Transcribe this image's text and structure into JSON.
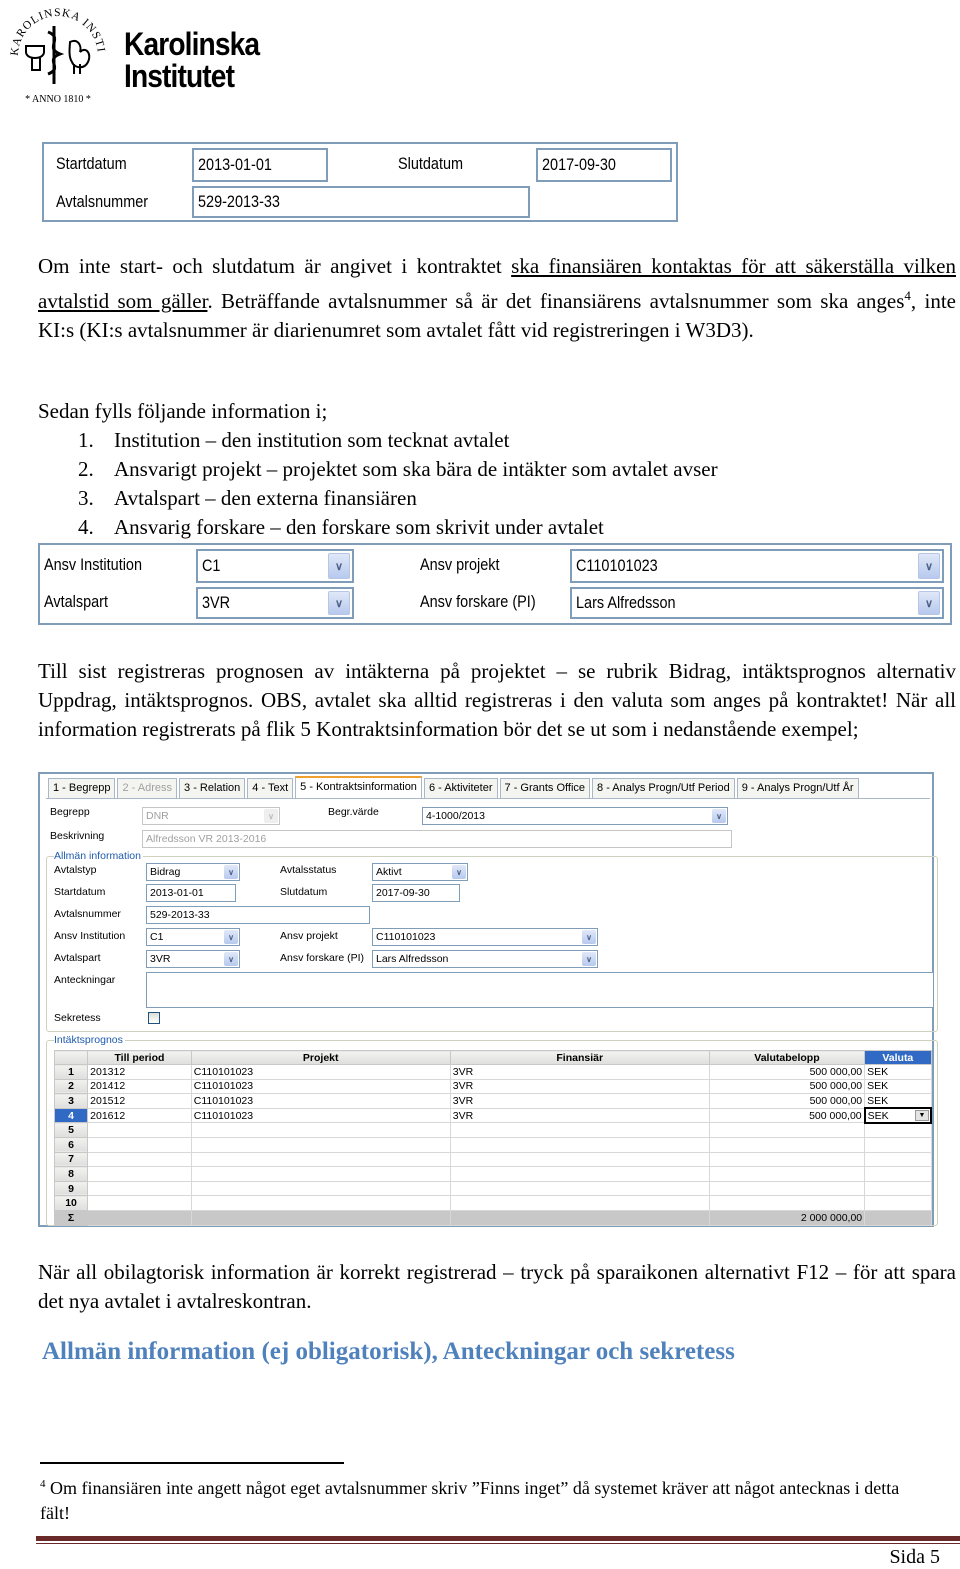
{
  "logo": {
    "seal_text": "KAROLINSKA INSTITUTET · ANNO 1810",
    "name_line1": "Karolinska",
    "name_line2": "Institutet"
  },
  "figure1": {
    "startdatum_label": "Startdatum",
    "startdatum_value": "2013-01-01",
    "slutdatum_label": "Slutdatum",
    "slutdatum_value": "2017-09-30",
    "avtalsnummer_label": "Avtalsnummer",
    "avtalsnummer_value": "529-2013-33"
  },
  "paragraph1": {
    "part1": "Om inte start- och slutdatum är angivet i kontraktet ",
    "underlined": "ska finansiären kontaktas för att säkerställa vilken avtalstid som gäller",
    "part2": ". Beträffande avtalsnummer så är det finansiärens avtalsnummer som ska anges",
    "footnote_ref": "4",
    "part3": ", inte KI:s (KI:s avtalsnummer är diarienumret som avtalet fått vid registreringen i W3D3)."
  },
  "list": {
    "intro": "Sedan fylls följande information i;",
    "items": [
      {
        "num": "1.",
        "text": "Institution – den institution som tecknat avtalet"
      },
      {
        "num": "2.",
        "text": "Ansvarigt projekt – projektet som ska bära de intäkter som avtalet avser"
      },
      {
        "num": "3.",
        "text": "Avtalspart – den externa finansiären"
      },
      {
        "num": "4.",
        "text": "Ansvarig forskare – den forskare som skrivit under avtalet"
      }
    ]
  },
  "figure2": {
    "ansv_institution_label": "Ansv Institution",
    "ansv_institution_value": "C1",
    "ansv_projekt_label": "Ansv projekt",
    "ansv_projekt_value": "C110101023",
    "avtalspart_label": "Avtalspart",
    "avtalspart_value": "3VR",
    "ansv_forskare_label": "Ansv forskare (PI)",
    "ansv_forskare_value": "Lars Alfredsson"
  },
  "paragraph2": "Till sist registreras prognosen av intäkterna på projektet – se rubrik Bidrag, intäktsprognos alternativ Uppdrag, intäktsprognos. OBS, avtalet ska alltid registreras i den valuta som anges på kontraktet! När all information registrerats på flik 5 Kontraktsinformation bör det se ut som i nedanstående exempel;",
  "app": {
    "tabs": [
      {
        "label": "1 - Begrepp",
        "state": "normal"
      },
      {
        "label": "2 - Adress",
        "state": "disabled"
      },
      {
        "label": "3 - Relation",
        "state": "normal"
      },
      {
        "label": "4 - Text",
        "state": "normal"
      },
      {
        "label": "5 - Kontraktsinformation",
        "state": "active"
      },
      {
        "label": "6 - Aktiviteter",
        "state": "normal"
      },
      {
        "label": "7 - Grants Office",
        "state": "normal"
      },
      {
        "label": "8 - Analys Progn/Utf Period",
        "state": "normal"
      },
      {
        "label": "9 - Analys Progn/Utf År",
        "state": "normal"
      }
    ],
    "begrepp_label": "Begrepp",
    "begrepp_value": "DNR",
    "begr_varde_label": "Begr.värde",
    "begr_varde_value": "4-1000/2013",
    "beskrivning_label": "Beskrivning",
    "beskrivning_value": "Alfredsson VR 2013-2016",
    "group_allman": "Allmän information",
    "avtalstyp_label": "Avtalstyp",
    "avtalstyp_value": "Bidrag",
    "avtalsstatus_label": "Avtalsstatus",
    "avtalsstatus_value": "Aktivt",
    "startdatum_label": "Startdatum",
    "startdatum_value": "2013-01-01",
    "slutdatum_label": "Slutdatum",
    "slutdatum_value": "2017-09-30",
    "avtalsnummer_label": "Avtalsnummer",
    "avtalsnummer_value": "529-2013-33",
    "ansv_institution_label": "Ansv Institution",
    "ansv_institution_value": "C1",
    "ansv_projekt_label": "Ansv projekt",
    "ansv_projekt_value": "C110101023",
    "avtalspart_label": "Avtalspart",
    "avtalspart_value": "3VR",
    "ansv_forskare_label": "Ansv forskare (PI)",
    "ansv_forskare_value": "Lars Alfredsson",
    "anteckningar_label": "Anteckningar",
    "anteckningar_value": "",
    "sekretess_label": "Sekretess",
    "sekretess_checked": false,
    "group_intakt": "Intäktsprognos",
    "grid": {
      "columns": [
        "Till period",
        "Projekt",
        "Finansiär",
        "Valutabelopp",
        "Valuta"
      ],
      "rows": [
        {
          "n": "1",
          "period": "201312",
          "projekt": "C110101023",
          "finansiar": "3VR",
          "belopp": "500 000,00",
          "valuta": "SEK"
        },
        {
          "n": "2",
          "period": "201412",
          "projekt": "C110101023",
          "finansiar": "3VR",
          "belopp": "500 000,00",
          "valuta": "SEK"
        },
        {
          "n": "3",
          "period": "201512",
          "projekt": "C110101023",
          "finansiar": "3VR",
          "belopp": "500 000,00",
          "valuta": "SEK"
        },
        {
          "n": "4",
          "period": "201612",
          "projekt": "C110101023",
          "finansiar": "3VR",
          "belopp": "500 000,00",
          "valuta": "SEK"
        },
        {
          "n": "5",
          "period": "",
          "projekt": "",
          "finansiar": "",
          "belopp": "",
          "valuta": ""
        },
        {
          "n": "6",
          "period": "",
          "projekt": "",
          "finansiar": "",
          "belopp": "",
          "valuta": ""
        },
        {
          "n": "7",
          "period": "",
          "projekt": "",
          "finansiar": "",
          "belopp": "",
          "valuta": ""
        },
        {
          "n": "8",
          "period": "",
          "projekt": "",
          "finansiar": "",
          "belopp": "",
          "valuta": ""
        },
        {
          "n": "9",
          "period": "",
          "projekt": "",
          "finansiar": "",
          "belopp": "",
          "valuta": ""
        },
        {
          "n": "10",
          "period": "",
          "projekt": "",
          "finansiar": "",
          "belopp": "",
          "valuta": ""
        }
      ],
      "sum_symbol": "Σ",
      "sum_value": "2 000 000,00",
      "selected_row": 4
    }
  },
  "paragraph3": "När all obilagtorisk information är korrekt registrerad – tryck på sparaikonen alternativt F12 – för att spara det nya avtalet i avtalreskontran.",
  "heading": "Allmän information (ej obligatorisk), Anteckningar och sekretess",
  "footnote": {
    "num": "4",
    "text": " Om finansiären inte angett något eget avtalsnummer skriv ”Finns inget” då systemet kräver att något antecknas i detta fält!"
  },
  "page": {
    "label": "Sida 5"
  },
  "colors": {
    "heading": "#4f81bd",
    "page_rule": "#6b2a2a",
    "win_border": "#7f9db9",
    "grid_selected": "#316ac5"
  }
}
